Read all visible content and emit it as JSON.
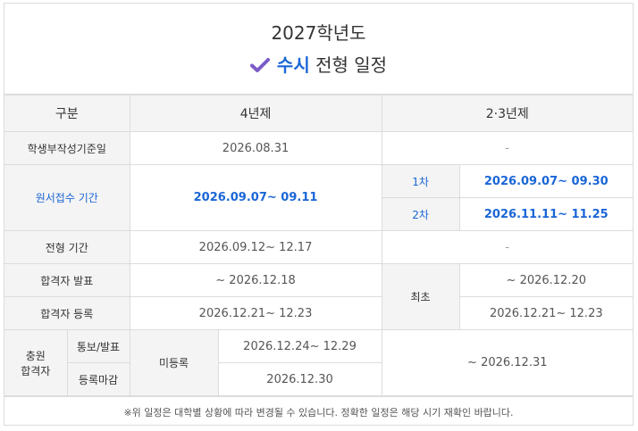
{
  "header": {
    "year": "2027학년도",
    "title_highlight": "수시",
    "title_rest": "전형 일정"
  },
  "table": {
    "col_header": {
      "category": "구분",
      "four_year": "4년제",
      "two_three_year": "2·3년제"
    },
    "rows": {
      "base_date": {
        "label": "학생부작성기준일",
        "four": "2026.08.31",
        "two": "-"
      },
      "application": {
        "label": "원서접수 기간",
        "four": "2026.09.07~ 09.11",
        "round1_label": "1차",
        "round1_value": "2026.09.07~ 09.30",
        "round2_label": "2차",
        "round2_value": "2026.11.11~ 11.25"
      },
      "screening": {
        "label": "전형 기간",
        "four": "2026.09.12~ 12.17",
        "two": "-"
      },
      "announcement": {
        "label": "합격자 발표",
        "four": "~ 2026.12.18",
        "two_label": "최초",
        "two": "~ 2026.12.20"
      },
      "registration": {
        "label": "합격자 등록",
        "four": "2026.12.21~ 12.23",
        "two": "2026.12.21~ 12.23"
      },
      "additional": {
        "label_line1": "충원",
        "label_line2": "합격자",
        "notice_label": "통보/발표",
        "deadline_label": "등록마감",
        "unregistered_label": "미등록",
        "notice_value": "2026.12.24~ 12.29",
        "deadline_value": "2026.12.30",
        "two": "~ 2026.12.31"
      }
    }
  },
  "footer": {
    "note": "※위 일정은 대학별 상황에 따라 변경될 수 있습니다. 정확한 일정은 해당 시기 재확인 바랍니다."
  },
  "colors": {
    "accent": "#1a66d6",
    "check": "#7b5cc9",
    "label_bg": "#f4f4f4",
    "border": "#dcdcdc"
  },
  "icons": {
    "title": "check-icon"
  }
}
